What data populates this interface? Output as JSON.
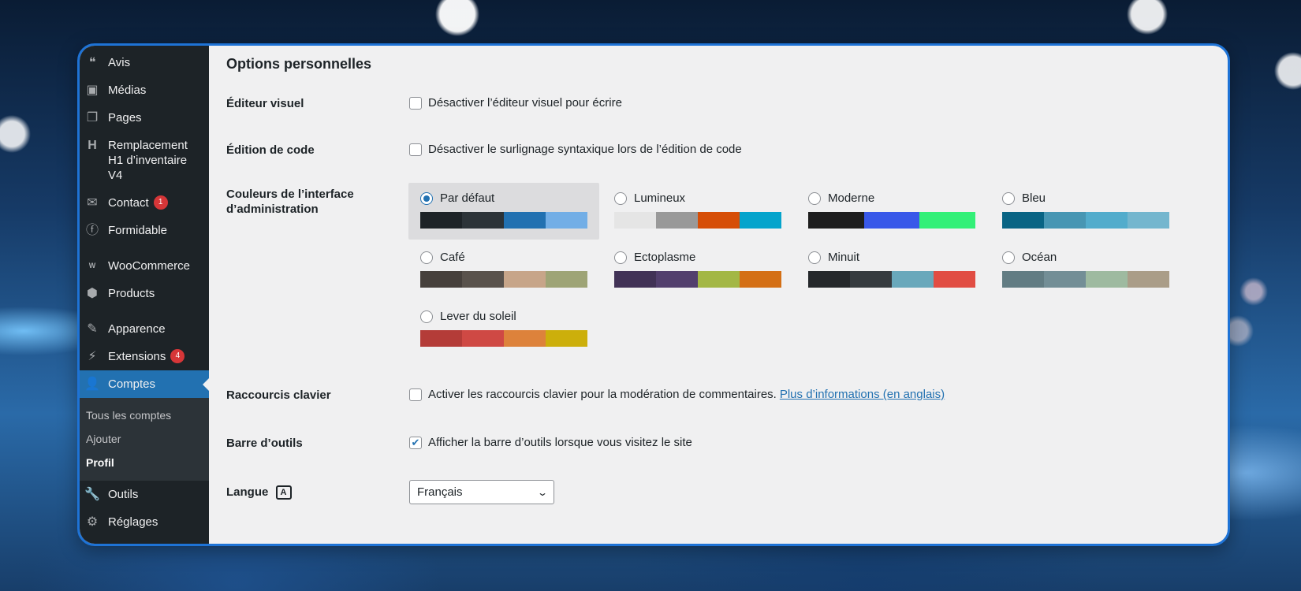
{
  "sidebar": {
    "items": [
      {
        "label": "Avis",
        "icon": "quote-icon"
      },
      {
        "label": "Médias",
        "icon": "media-icon"
      },
      {
        "label": "Pages",
        "icon": "pages-icon"
      },
      {
        "label": "Remplacement H1 d’inventaire V4",
        "icon": "heading-icon"
      },
      {
        "label": "Contact",
        "icon": "mail-icon",
        "badge": "1"
      },
      {
        "label": "Formidable",
        "icon": "formidable-icon"
      },
      {
        "label": "WooCommerce",
        "icon": "woocommerce-icon"
      },
      {
        "label": "Products",
        "icon": "products-icon"
      },
      {
        "label": "Apparence",
        "icon": "appearance-icon"
      },
      {
        "label": "Extensions",
        "icon": "plugins-icon",
        "badge": "4"
      },
      {
        "label": "Comptes",
        "icon": "user-icon"
      },
      {
        "label": "Outils",
        "icon": "tools-icon"
      },
      {
        "label": "Réglages",
        "icon": "settings-icon"
      }
    ],
    "submenu": [
      {
        "label": "Tous les comptes"
      },
      {
        "label": "Ajouter"
      },
      {
        "label": "Profil"
      }
    ]
  },
  "main": {
    "title": "Options personnelles",
    "visual_editor": {
      "label": "Éditeur visuel",
      "checkbox_label": "Désactiver l’éditeur visuel pour écrire",
      "checked": false
    },
    "code_editing": {
      "label": "Édition de code",
      "checkbox_label": "Désactiver le surlignage syntaxique lors de l’édition de code",
      "checked": false
    },
    "admin_colors": {
      "label": "Couleurs de l’interface d’administration",
      "schemes": [
        {
          "name": "Par défaut",
          "selected": true,
          "colors": [
            "#1d2327",
            "#2c3338",
            "#2271b1",
            "#72aee6"
          ]
        },
        {
          "name": "Lumineux",
          "selected": false,
          "colors": [
            "#e5e5e5",
            "#999999",
            "#d64e07",
            "#04a4cc"
          ]
        },
        {
          "name": "Moderne",
          "selected": false,
          "colors": [
            "#1e1e1e",
            "#3858e9",
            "#33f078"
          ]
        },
        {
          "name": "Bleu",
          "selected": false,
          "colors": [
            "#096484",
            "#4796b3",
            "#52accc",
            "#74b6ce"
          ]
        },
        {
          "name": "Café",
          "selected": false,
          "colors": [
            "#46403c",
            "#59524c",
            "#c7a589",
            "#9ea476"
          ]
        },
        {
          "name": "Ectoplasme",
          "selected": false,
          "colors": [
            "#413256",
            "#523f6d",
            "#a3b745",
            "#d46f15"
          ]
        },
        {
          "name": "Minuit",
          "selected": false,
          "colors": [
            "#25282b",
            "#363b3f",
            "#69a8bb",
            "#e14d43"
          ]
        },
        {
          "name": "Océan",
          "selected": false,
          "colors": [
            "#627c83",
            "#738e96",
            "#9ebaa0",
            "#aa9d88"
          ]
        },
        {
          "name": "Lever du soleil",
          "selected": false,
          "colors": [
            "#b43c38",
            "#cf4944",
            "#dd823b",
            "#ccaf0b"
          ]
        }
      ]
    },
    "shortcuts": {
      "label": "Raccourcis clavier",
      "checkbox_label": "Activer les raccourcis clavier pour la modération de commentaires.",
      "link": "Plus d’informations (en anglais)",
      "checked": false
    },
    "toolbar": {
      "label": "Barre d’outils",
      "checkbox_label": "Afficher la barre d’outils lorsque vous visitez le site",
      "checked": true
    },
    "language": {
      "label": "Langue",
      "icon": "translation-icon",
      "value": "Français"
    }
  }
}
